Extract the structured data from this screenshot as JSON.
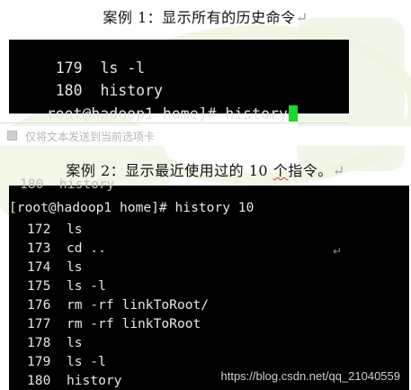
{
  "caption1": {
    "text": "案例 1：显示所有的历史命令",
    "para_mark": "↵"
  },
  "terminal1": {
    "lines": [
      {
        "num": "179",
        "cmd": "ls -l"
      },
      {
        "num": "180",
        "cmd": "history"
      }
    ],
    "prompt": "root@hadoop1 home]# history"
  },
  "info_bar": {
    "text": "仅将文本发送到当前选项卡"
  },
  "caption2": {
    "prefix": "案例 2：显示最近使用过的 10 ",
    "underlined": "个",
    "suffix": "指令。",
    "para_mark": "↵"
  },
  "terminal2": {
    "clipped_top": "180  history",
    "prompt": "[root@hadoop1 home]# history 10",
    "lines": [
      {
        "num": "172",
        "cmd": "ls"
      },
      {
        "num": "173",
        "cmd": "cd .."
      },
      {
        "num": "174",
        "cmd": "ls"
      },
      {
        "num": "175",
        "cmd": "ls -l"
      },
      {
        "num": "176",
        "cmd": "rm -rf linkToRoot/"
      },
      {
        "num": "177",
        "cmd": "rm -rf linkToRoot"
      },
      {
        "num": "178",
        "cmd": "ls"
      },
      {
        "num": "179",
        "cmd": "ls -l"
      },
      {
        "num": "180",
        "cmd": "history"
      }
    ],
    "enter_mark": "↵"
  },
  "watermark": {
    "credit": "https://blog.csdn.net/qq_21040559"
  },
  "colors": {
    "terminal_bg": "#000000",
    "terminal_fg": "#e6e6e6",
    "cursor": "#1dd52c"
  }
}
